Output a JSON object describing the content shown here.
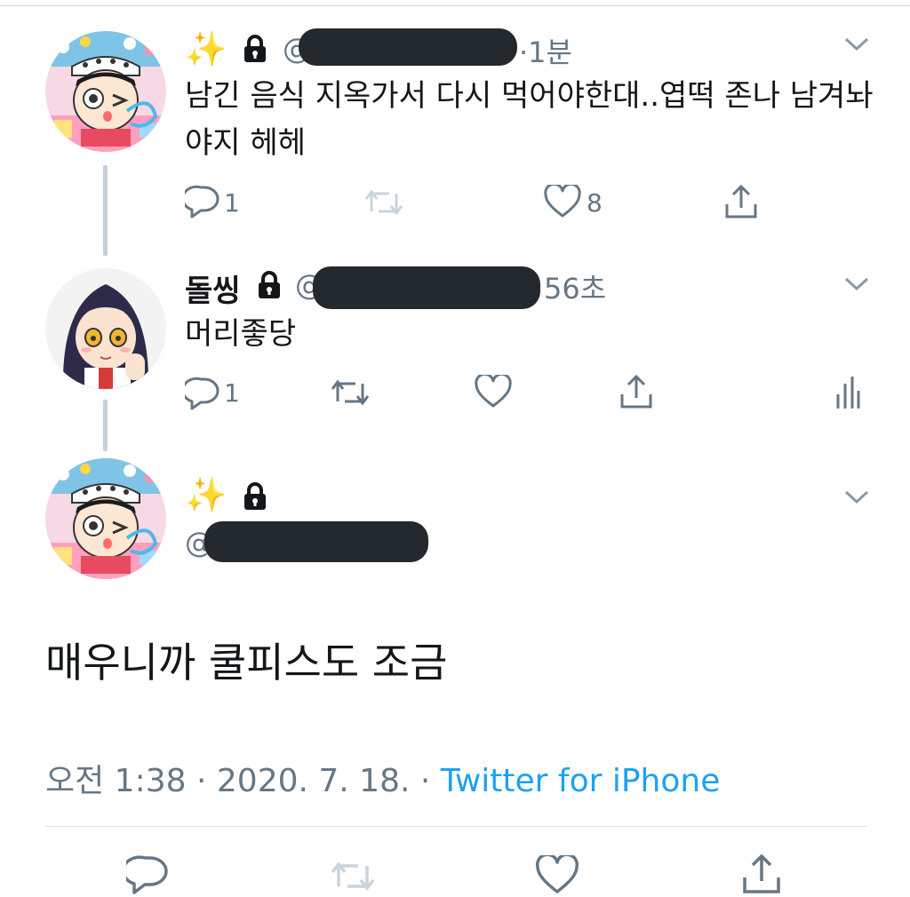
{
  "tweets": [
    {
      "name_emoji": "✨",
      "time": "1분",
      "text": "남긴 음식 지옥가서 다시 먹어야한대..엽떡 존나 남겨놔야지 헤헤",
      "reply_count": "1",
      "like_count": "8"
    },
    {
      "name": "돌씽",
      "time": "56초",
      "text": "머리좋당",
      "reply_count": "1"
    }
  ],
  "main_tweet": {
    "name_emoji": "✨",
    "handle_prefix": "@",
    "text": "매우니까 쿨피스도 조금",
    "time": "오전 1:38",
    "sep1": "·",
    "date": "2020. 7. 18.",
    "sep2": "·",
    "source": "Twitter for iPhone"
  },
  "colors": {
    "accent": "#1da1f2",
    "secondary_text": "#657786",
    "thread_line": "#c5d0da",
    "redaction": "#24292e"
  },
  "icons": [
    "chevron-down-icon",
    "reply-icon",
    "retweet-icon",
    "like-icon",
    "share-icon",
    "analytics-icon",
    "lock-icon",
    "sparkles-icon"
  ]
}
